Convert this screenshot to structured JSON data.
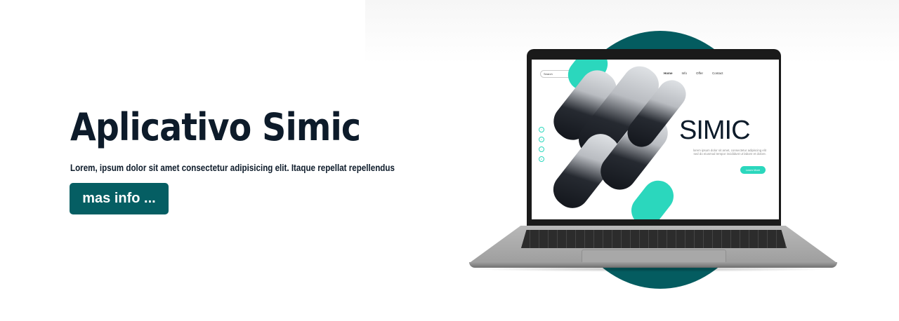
{
  "hero": {
    "title": "Aplicativo Simic",
    "subtitle": "Lorem, ipsum dolor sit amet consectetur adipisicing elit. Itaque repellat repellendus",
    "cta_label": "mas info ...",
    "accent_color": "#055e63",
    "circle_color": "#045c60"
  },
  "mockup": {
    "search_placeholder": "Search",
    "search_icon": "search-icon",
    "nav": [
      "Home",
      "Info",
      "Offer",
      "Contact"
    ],
    "brand": "SIMIC",
    "copy": "lorem ipsum dolor sit amet, consectetur adipiscing elit sed do eiusmod tempor incididunt ut labore et dolore.",
    "learn_more": "Learn More",
    "accent_color": "#2bd7bd",
    "social_icons": [
      "facebook-icon",
      "instagram-icon",
      "twitter-icon",
      "linkedin-icon"
    ]
  }
}
